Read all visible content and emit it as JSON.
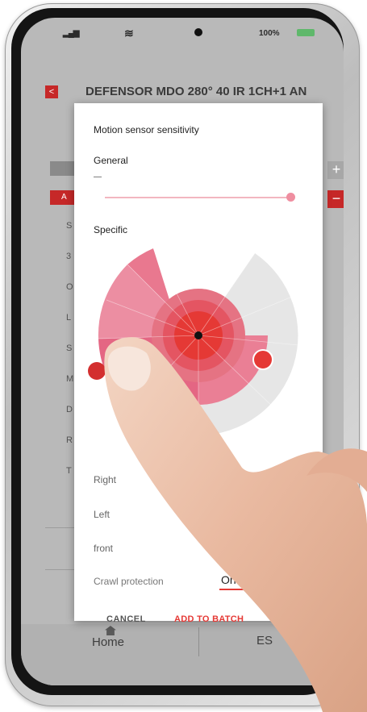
{
  "status_bar": {
    "battery_text": "100%"
  },
  "header": {
    "back_label": "<",
    "title": "DEFENSOR MDO 280° 40 IR 1CH+1  AN"
  },
  "background_list": {
    "tab_letter": "A",
    "row_letters": [
      "S",
      "3",
      "O",
      "L",
      "S",
      "M",
      "D",
      "R",
      "T"
    ]
  },
  "dialog": {
    "title": "Motion sensor sensitivity",
    "general_label": "General",
    "general_dash": "—",
    "general_level": 1.0,
    "specific_label": "Specific",
    "options": [
      "Right",
      "Left",
      "front"
    ],
    "crawl_label": "Crawl protection",
    "crawl_value": "On",
    "cancel_label": "CANCEL",
    "add_label": "ADD TO BATCH"
  },
  "bottom_nav": {
    "home_label": "Home",
    "second_label": "ES"
  },
  "colors": {
    "accent": "#e53935",
    "header_red": "#c62828",
    "sector_pink": "#e9788f",
    "sector_grey": "#e6e6e6"
  },
  "icons": {
    "back": "chevron-left-icon",
    "home": "home-icon",
    "plus": "plus-icon",
    "minus": "minus-icon"
  }
}
